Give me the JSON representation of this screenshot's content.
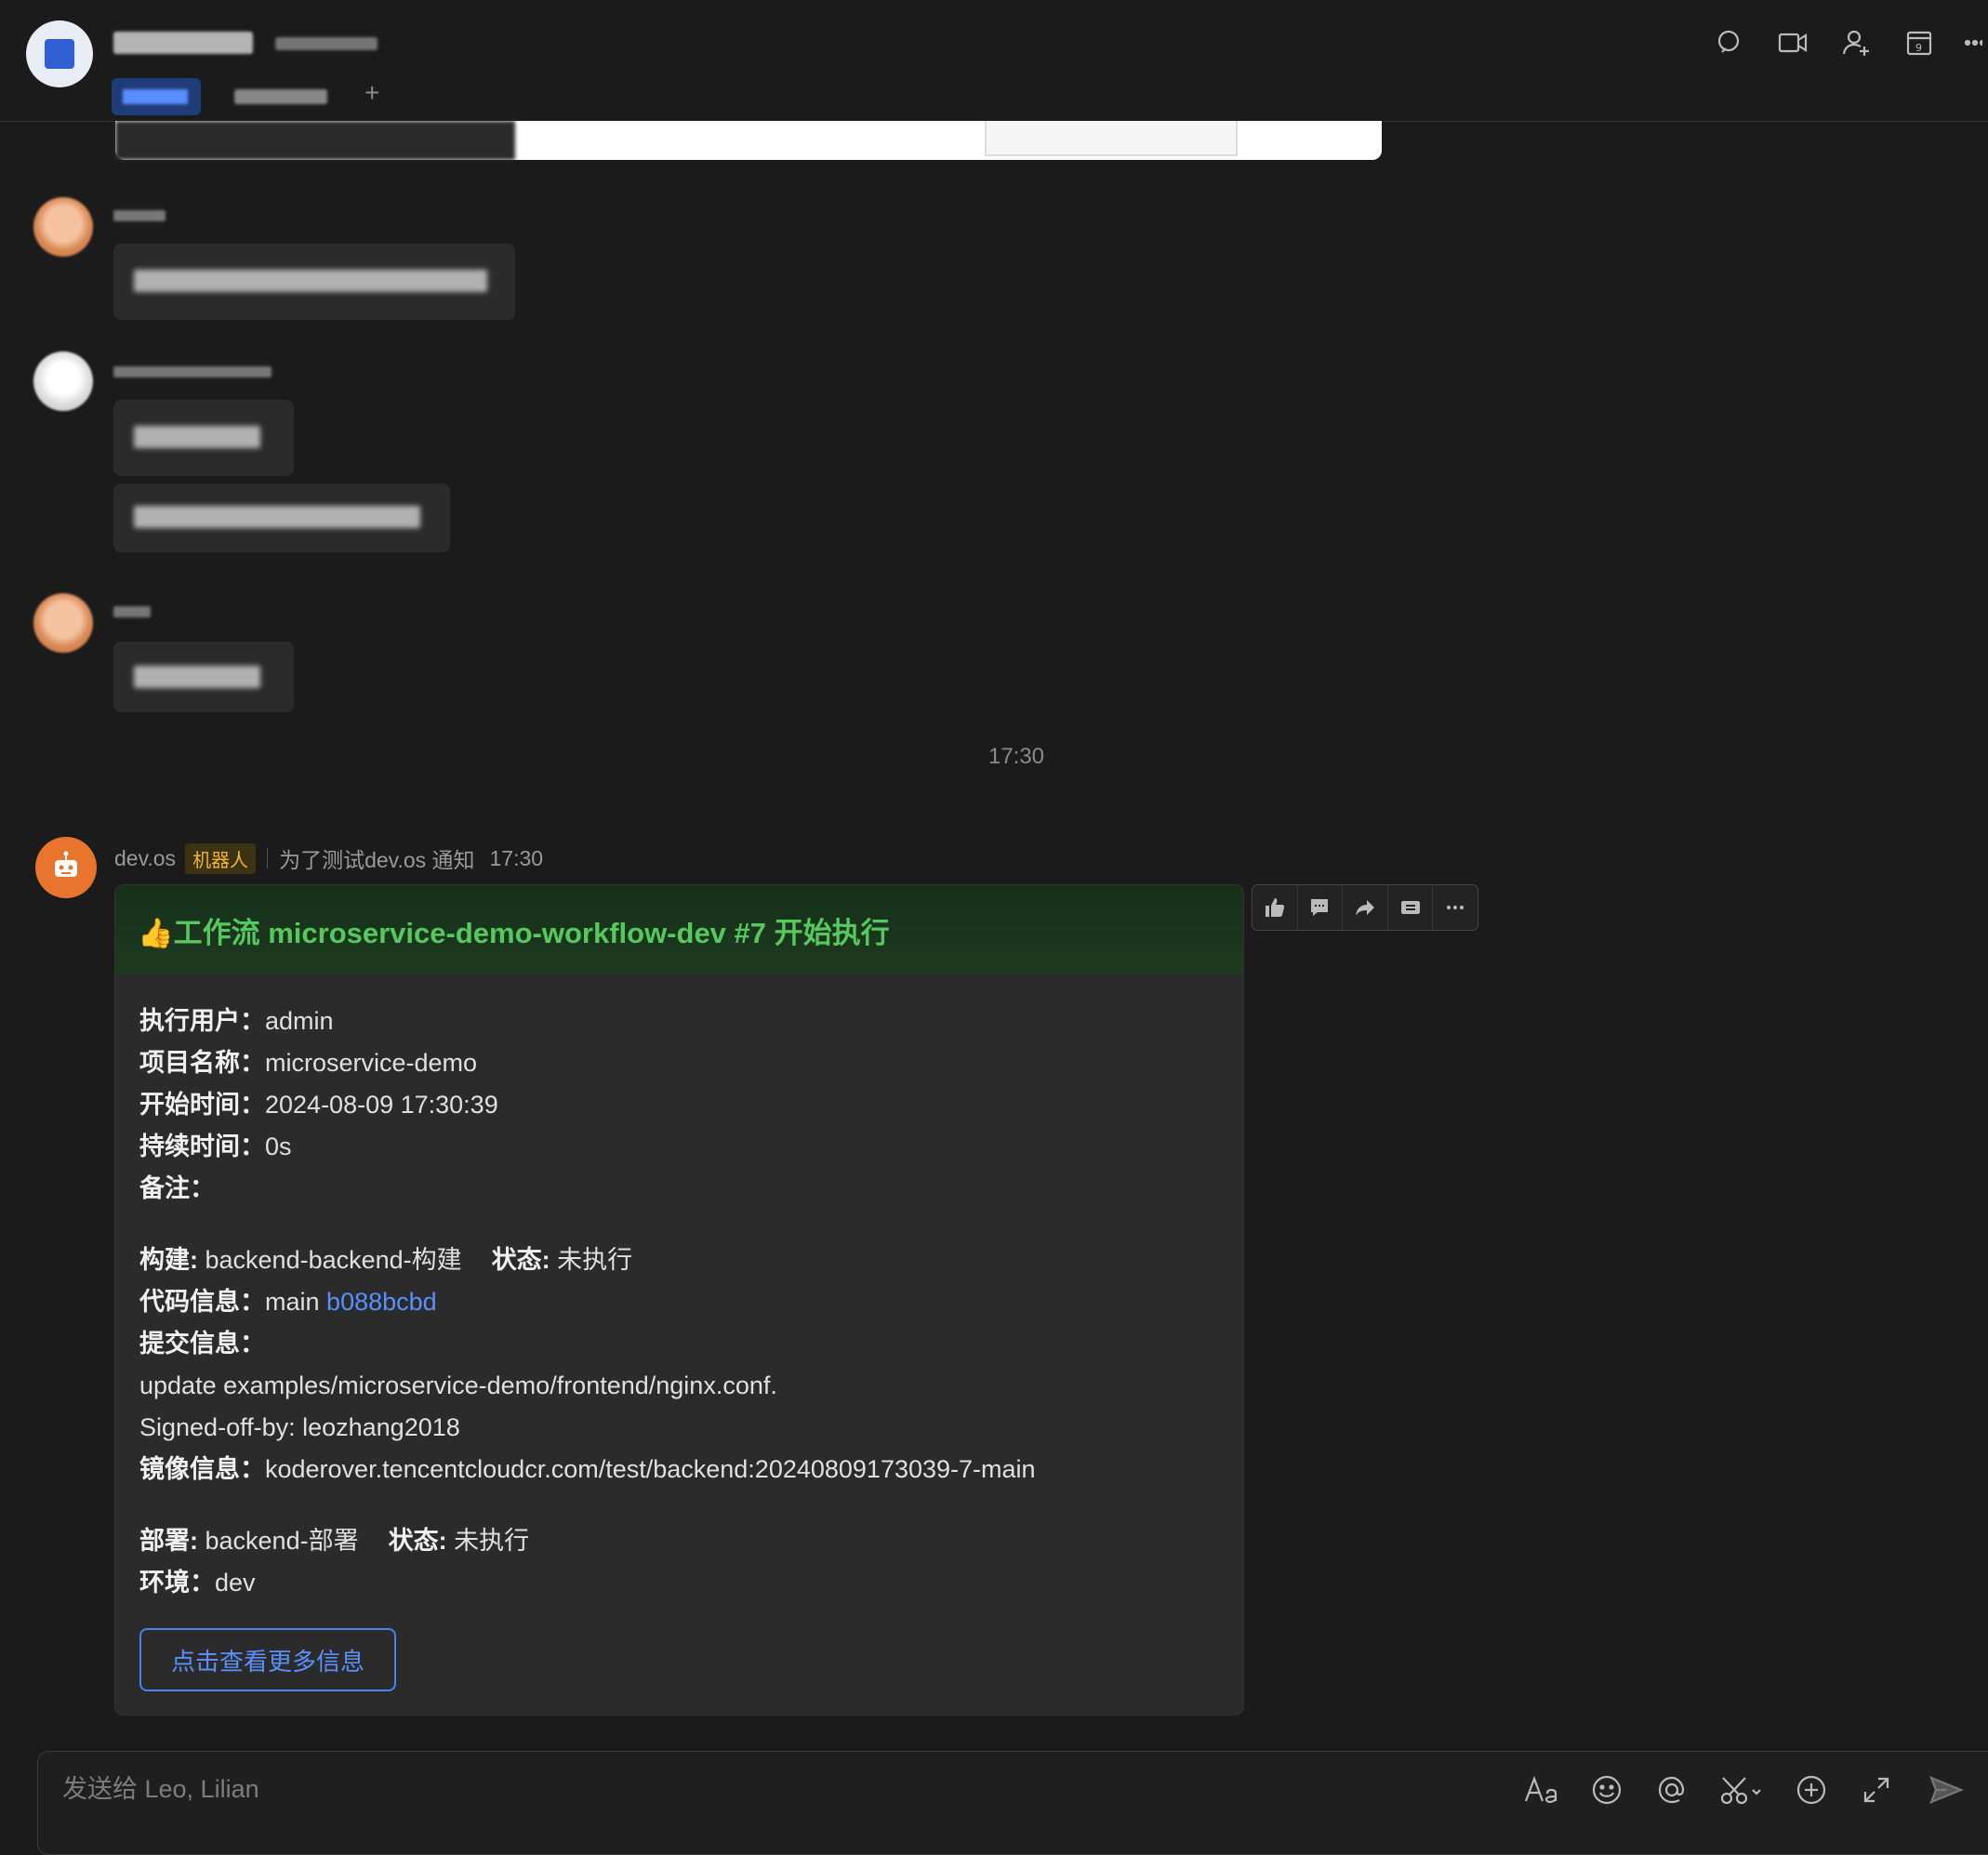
{
  "header": {
    "icons": [
      "search-icon",
      "video-call-icon",
      "add-member-icon",
      "calendar-icon",
      "more-icon"
    ],
    "calendar_day": "9",
    "tab_add": "+"
  },
  "timeline": {
    "divider_time": "17:30"
  },
  "bot_message": {
    "sender": "dev.os",
    "badge": "机器人",
    "source": "为了测试dev.os 通知",
    "time": "17:30",
    "card": {
      "title_emoji": "👍",
      "title": "工作流 microservice-demo-workflow-dev #7 开始执行",
      "fields": {
        "user_key": "执行用户",
        "user_val": "admin",
        "project_key": "项目名称",
        "project_val": "microservice-demo",
        "start_key": "开始时间",
        "start_val": "2024-08-09 17:30:39",
        "duration_key": "持续时间",
        "duration_val": "0s",
        "note_key": "备注"
      },
      "build": {
        "label": "构建",
        "value": "backend-backend-构建",
        "status_label": "状态",
        "status": "未执行",
        "code_key": "代码信息",
        "branch": "main",
        "commit": "b088bcbd",
        "commit_msg_key": "提交信息",
        "commit_msg_line1": "update examples/microservice-demo/frontend/nginx.conf.",
        "commit_msg_line2": "Signed-off-by: leozhang2018",
        "image_key": "镜像信息",
        "image_val": "koderover.tencentcloudcr.com/test/backend:20240809173039-7-main"
      },
      "deploy": {
        "label": "部署",
        "value": "backend-部署",
        "status_label": "状态",
        "status": "未执行",
        "env_key": "环境",
        "env_val": "dev"
      },
      "more_button": "点击查看更多信息"
    },
    "actions": [
      "thumbs-up-icon",
      "comment-icon",
      "forward-icon",
      "quote-icon",
      "more-icon"
    ]
  },
  "composer": {
    "placeholder": "发送给 Leo, Lilian",
    "tools": [
      "format-icon",
      "emoji-icon",
      "mention-icon",
      "screenshot-icon",
      "plus-icon",
      "expand-icon",
      "send-icon"
    ]
  }
}
